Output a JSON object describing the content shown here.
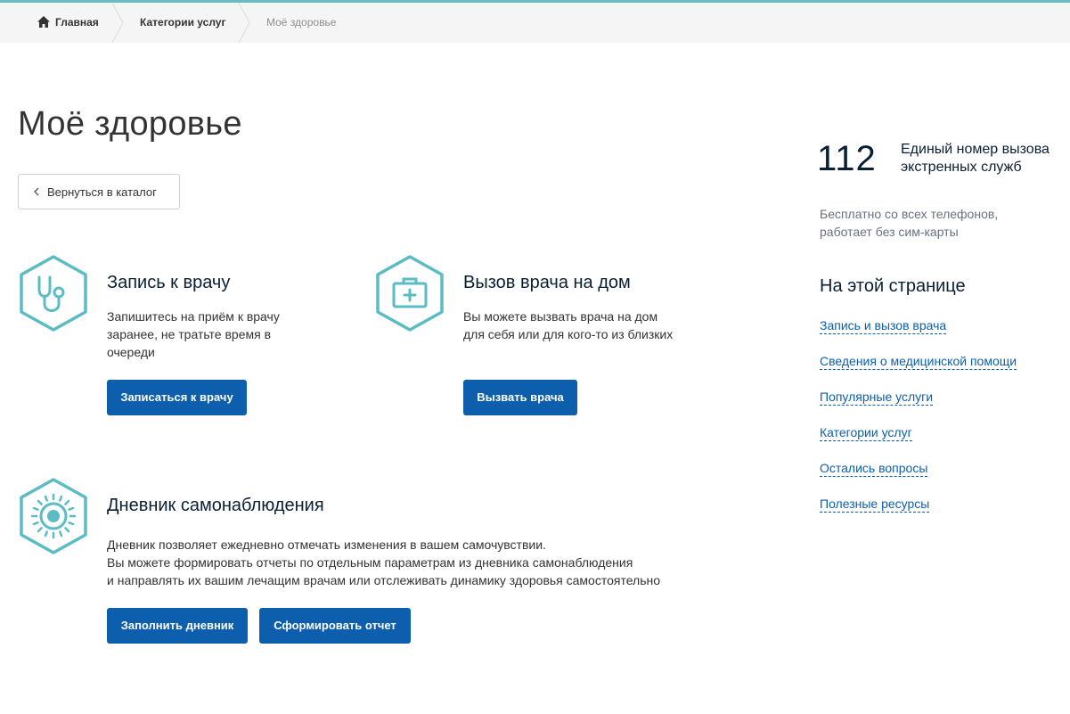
{
  "breadcrumbs": {
    "home": "Главная",
    "categories": "Категории услуг",
    "current": "Моё здоровье"
  },
  "page": {
    "title": "Моё здоровье",
    "back_button": "Вернуться в каталог"
  },
  "cards": {
    "appointment": {
      "title": "Запись к врачу",
      "text": "Запишитесь на приём к врачу заранее, не тратьте время в очереди",
      "button": "Записаться к врачу"
    },
    "home_visit": {
      "title": "Вызов врача на дом",
      "text": "Вы можете вызвать врача на дом для себя или для кого-то из близких",
      "button": "Вызвать врача"
    },
    "diary": {
      "title": "Дневник самонаблюдения",
      "text_lines": [
        "Дневник позволяет ежедневно отмечать изменения в вашем самочувствии.",
        "Вы можете формировать отчеты по отдельным параметрам из дневника самонаблюдения",
        "и направлять их вашим лечащим врачам или отслеживать динамику здоровья самостоятельно"
      ],
      "buttons": [
        "Заполнить дневник",
        "Сформировать отчет"
      ]
    }
  },
  "emergency": {
    "number": "112",
    "description": "Единый номер вызова экстренных служб",
    "note": "Бесплатно со всех телефонов, работает без сим-карты"
  },
  "toc": {
    "title": "На этой странице",
    "links": [
      "Запись и вызов врача",
      "Сведения о медицинской помощи",
      "Популярные услуги",
      "Категории услуг",
      "Остались вопросы",
      "Полезные ресурсы"
    ]
  },
  "icons": {
    "breadcrumb_home": "home-icon",
    "appointment": "stethoscope-icon",
    "home_visit": "first-aid-kit-icon",
    "diary": "virus-icon"
  },
  "colors": {
    "accent_line": "#6bbcc0",
    "icon_teal": "#5bbcc3",
    "primary_button": "#0d5fad",
    "link": "#0d5fad"
  }
}
